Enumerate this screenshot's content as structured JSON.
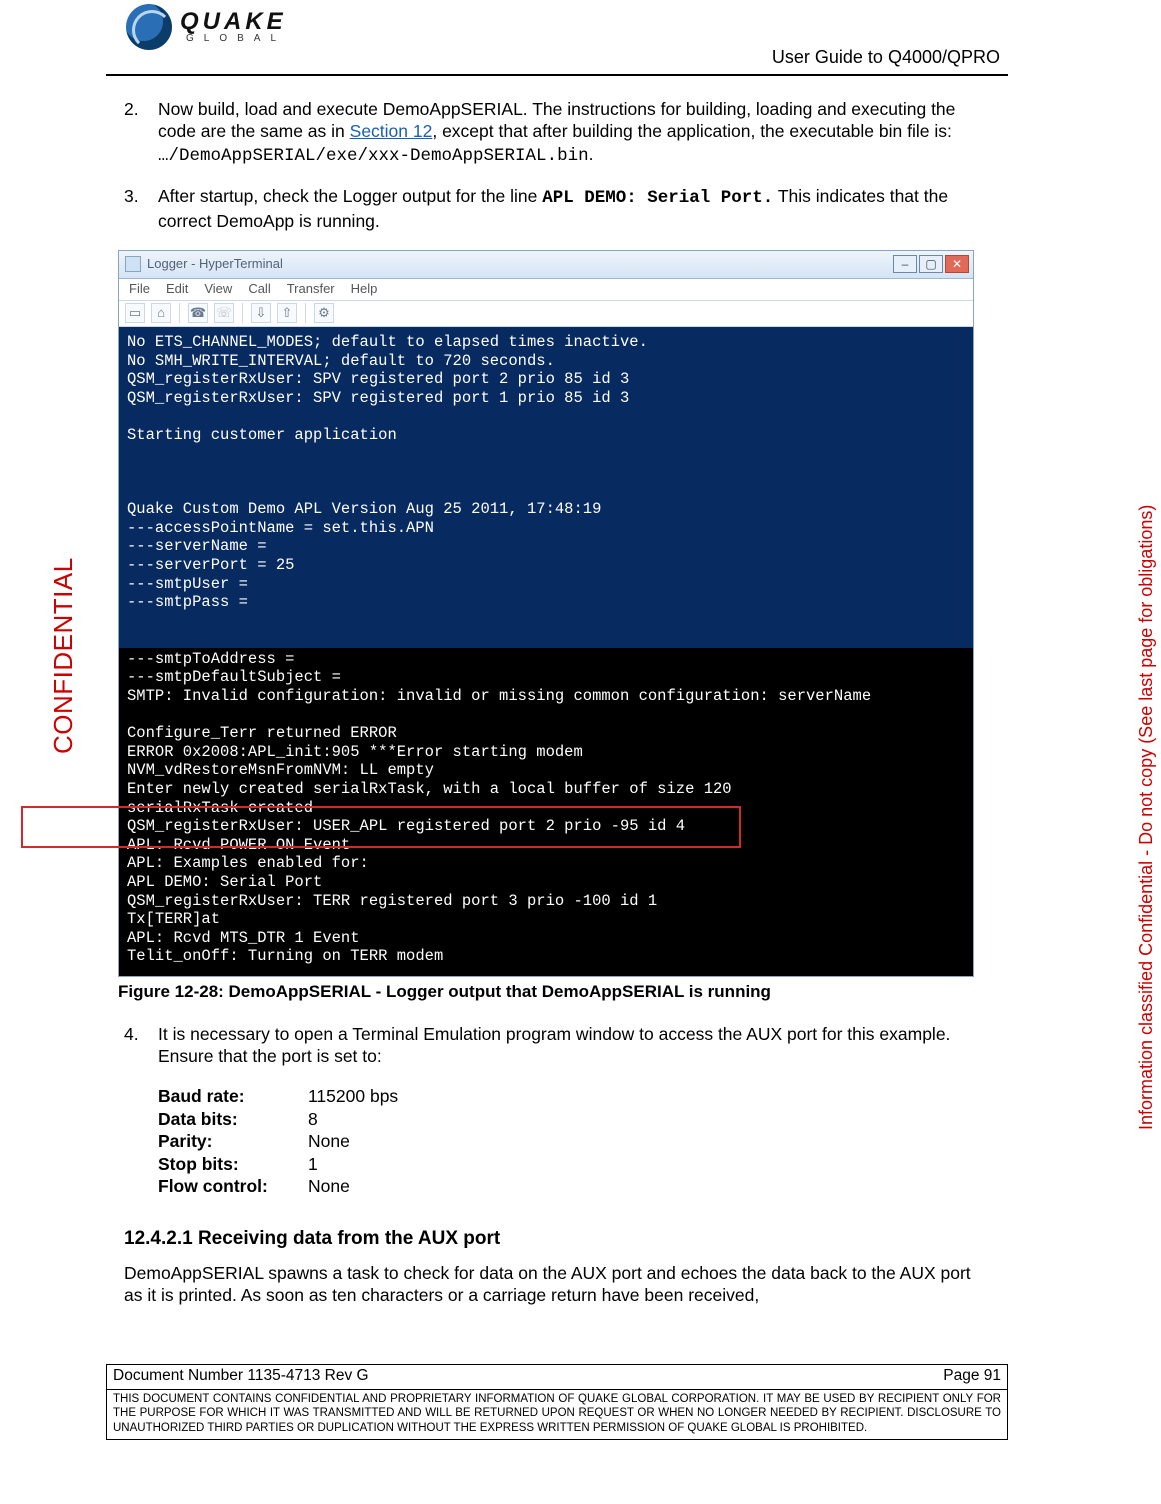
{
  "header": {
    "logo_main": "QUAKE",
    "logo_sub": "GLOBAL",
    "doc_title": "User Guide to Q4000/QPRO"
  },
  "side": {
    "confidential": "CONFIDENTIAL",
    "info": "Information classified Confidential - Do not copy (See last page for obligations)"
  },
  "steps": {
    "s2_num": "2.",
    "s2_a": "Now build, load and execute DemoAppSERIAL.  The instructions for building, loading and executing the code are the same as in ",
    "s2_link": "Section 12",
    "s2_b": ", except that after building the application, the executable bin file is:  ",
    "s2_path": "…/DemoAppSERIAL/exe/xxx-DemoAppSERIAL.bin",
    "s2_c": ".",
    "s3_num": "3.",
    "s3_a": "After startup, check the Logger output for the line ",
    "s3_code": "APL DEMO: Serial Port.",
    "s3_b": "  This indicates that the correct DemoApp is running.",
    "s4_num": "4.",
    "s4_txt": "It is necessary to open a Terminal Emulation program window to access the AUX port for this example.  Ensure that the port is set to:"
  },
  "terminal": {
    "title": "Logger - HyperTerminal",
    "menu": {
      "file": "File",
      "edit": "Edit",
      "view": "View",
      "call": "Call",
      "transfer": "Transfer",
      "help": "Help"
    },
    "upper": "No ETS_CHANNEL_MODES; default to elapsed times inactive.\nNo SMH_WRITE_INTERVAL; default to 720 seconds.\nQSM_registerRxUser: SPV registered port 2 prio 85 id 3\nQSM_registerRxUser: SPV registered port 1 prio 85 id 3\n\nStarting customer application\n\n\n\nQuake Custom Demo APL Version Aug 25 2011, 17:48:19\n---accessPointName = set.this.APN\n---serverName =\n---serverPort = 25\n---smtpUser =\n---smtpPass =",
    "lower": "---smtpToAddress =\n---smtpDefaultSubject =\nSMTP: Invalid configuration: invalid or missing common configuration: serverName\n\nConfigure_Terr returned ERROR\nERROR 0x2008:APL_init:905 ***Error starting modem\nNVM_vdRestoreMsnFromNVM: LL empty\nEnter newly created serialRxTask, with a local buffer of size 120\nserialRxTask created\nQSM_registerRxUser: USER_APL registered port 2 prio -95 id 4\nAPL: Rcvd POWER ON Event\nAPL: Examples enabled for:\nAPL DEMO: Serial Port\nQSM_registerRxUser: TERR registered port 3 prio -100 id 1\nTx[TERR]at\nAPL: Rcvd MTS_DTR 1 Event\nTelit_onOff: Turning on TERR modem"
  },
  "figure_caption": "Figure 12-28:  DemoAppSERIAL -  Logger output that DemoAppSERIAL is running",
  "serial": {
    "baud_k": "Baud rate:",
    "baud_v": "115200 bps",
    "data_k": "Data bits:",
    "data_v": "8",
    "parity_k": "Parity:",
    "parity_v": "None",
    "stop_k": "Stop bits:",
    "stop_v": "1",
    "flow_k": "Flow control:",
    "flow_v": "None"
  },
  "section": {
    "num_title": "12.4.2.1 Receiving data from the AUX port",
    "para": "DemoAppSERIAL spawns a task to check for data on the AUX port and echoes the data back to the AUX port as it is printed.  As soon as ten characters or a carriage return have been received,"
  },
  "footer": {
    "docnum": "Document Number 1135-4713   Rev G",
    "page": "Page 91",
    "legal": "THIS DOCUMENT CONTAINS CONFIDENTIAL AND PROPRIETARY INFORMATION OF QUAKE GLOBAL CORPORATION.   IT MAY BE USED BY RECIPIENT ONLY FOR THE PURPOSE FOR WHICH IT WAS TRANSMITTED AND WILL BE RETURNED UPON REQUEST OR WHEN NO LONGER NEEDED BY RECIPIENT.  DISCLOSURE TO UNAUTHORIZED THIRD PARTIES OR DUPLICATION WITHOUT THE EXPRESS WRITTEN PERMISSION OF QUAKE GLOBAL IS PROHIBITED."
  }
}
